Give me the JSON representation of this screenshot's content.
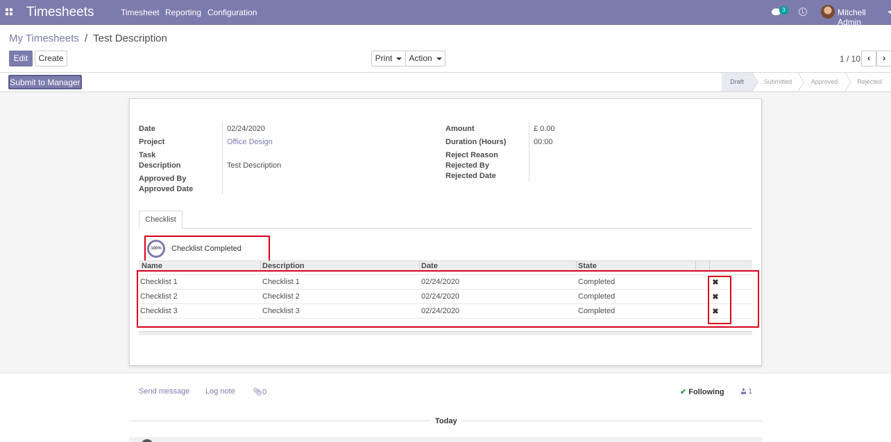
{
  "navbar": {
    "brand": "Timesheets",
    "menu": [
      "Timesheet",
      "Reporting",
      "Configuration"
    ],
    "messages_count": "3",
    "user_name": "Mitchell Admin"
  },
  "breadcrumb": {
    "parent": "My Timesheets",
    "separator": "/",
    "current": "Test Description"
  },
  "buttons": {
    "edit": "Edit",
    "create": "Create",
    "print": "Print",
    "action": "Action",
    "submit_to_manager": "Submit to Manager"
  },
  "pager": {
    "value": "1 / 10"
  },
  "statusbar": {
    "stages": [
      "Draft",
      "Submitted",
      "Approved",
      "Rejected"
    ],
    "active_stage": "Draft"
  },
  "form": {
    "left": [
      {
        "label": "Date",
        "value": "02/24/2020"
      },
      {
        "label": "Project",
        "value": "Office Design"
      },
      {
        "label": "Task",
        "value": ""
      },
      {
        "label": "Description",
        "value": "Test Description"
      },
      {
        "label": "Approved By",
        "value": ""
      },
      {
        "label": "Approved Date",
        "value": ""
      }
    ],
    "right": [
      {
        "label": "Amount",
        "value": "£ 0.00"
      },
      {
        "label": "Duration (Hours)",
        "value": "00:00"
      },
      {
        "label": "Reject Reason",
        "value": ""
      },
      {
        "label": "Rejected By",
        "value": ""
      },
      {
        "label": "Rejected Date",
        "value": ""
      }
    ]
  },
  "notebook": {
    "tabs": [
      "Checklist"
    ]
  },
  "checklist": {
    "progress_label": "100%",
    "progress_fraction": 1.0,
    "status_text": "Checklist Completed",
    "columns": [
      "Name",
      "Description",
      "Date",
      "State"
    ],
    "rows": [
      {
        "name": "Checklist 1",
        "description": "Checklist 1",
        "date": "02/24/2020",
        "state": "Completed"
      },
      {
        "name": "Checklist 2",
        "description": "Checklist 2",
        "date": "02/24/2020",
        "state": "Completed"
      },
      {
        "name": "Checklist 3",
        "description": "Checklist 3",
        "date": "02/24/2020",
        "state": "Completed"
      }
    ]
  },
  "chatter": {
    "send_message": "Send message",
    "log_note": "Log note",
    "attachments_count": "0",
    "following": "Following",
    "followers_count": "1",
    "date_separator": "Today"
  },
  "colors": {
    "primary": "#7c7bad",
    "highlight": "#d9001b",
    "following_check": "#28a745"
  }
}
